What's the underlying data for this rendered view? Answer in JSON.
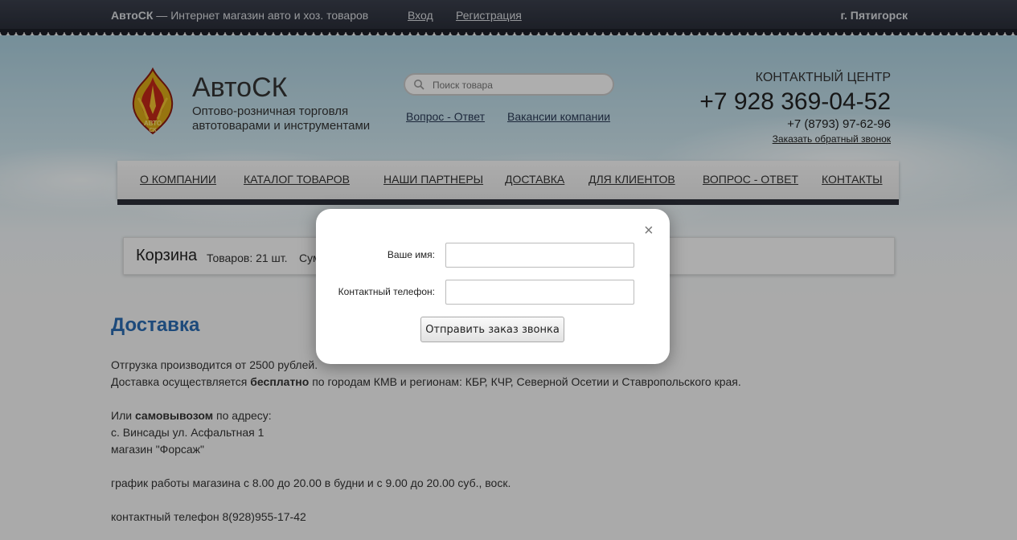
{
  "topbar": {
    "site_title_bold": "АвтоСК",
    "site_title_rest": " — Интернет магазин авто и хоз. товаров",
    "login": "Вход",
    "register": "Регистрация",
    "city": "г. Пятигорск"
  },
  "header": {
    "brand": "АвтоСК",
    "tagline": "Оптово-розничная торговля автотоварами и инструментами",
    "logo_text": "АВТО СК",
    "search_placeholder": "Поиск товара",
    "links": [
      "Вопрос - Ответ",
      "Вакансии компании"
    ],
    "contact_title": "КОНТАКТНЫЙ ЦЕНТР",
    "phone_main": "+7 928 369-04-52",
    "phone_alt": "+7 (8793) 97-62-96",
    "callback": "Заказать обратный звонок"
  },
  "nav": [
    "О КОМПАНИИ",
    "КАТАЛОГ ТОВАРОВ",
    "НАШИ ПАРТНЕРЫ",
    "ДОСТАВКА",
    "ДЛЯ КЛИЕНТОВ",
    "ВОПРОС - ОТВЕТ",
    "КОНТАКТЫ"
  ],
  "cart": {
    "title": "Корзина",
    "count": "Товаров: 21 шт.",
    "sum": "Сум"
  },
  "content": {
    "title": "Доставка",
    "p1": "Отгрузка производится от 2500 рублей.",
    "p2_pre": "Доставка осуществляется ",
    "p2_bold": "бесплатно",
    "p2_post": " по городам КМВ и регионам: КБР, КЧР, Северной Осетии и Ставропольского края.",
    "p3_pre": "Или ",
    "p3_bold": "самовывозом",
    "p3_post": " по адресу:",
    "p4": "с. Винсады ул. Асфальтная 1",
    "p5": "магазин \"Форсаж\"",
    "p6": "график работы магазина с 8.00 до 20.00 в будни и с 9.00 до 20.00 суб., воск.",
    "p7": "контактный телефон 8(928)955-17-42"
  },
  "modal": {
    "close": "×",
    "name_label": "Ваше имя:",
    "phone_label": "Контактный телефон:",
    "name_value": "",
    "phone_value": "",
    "submit": "Отправить заказ звонка"
  }
}
